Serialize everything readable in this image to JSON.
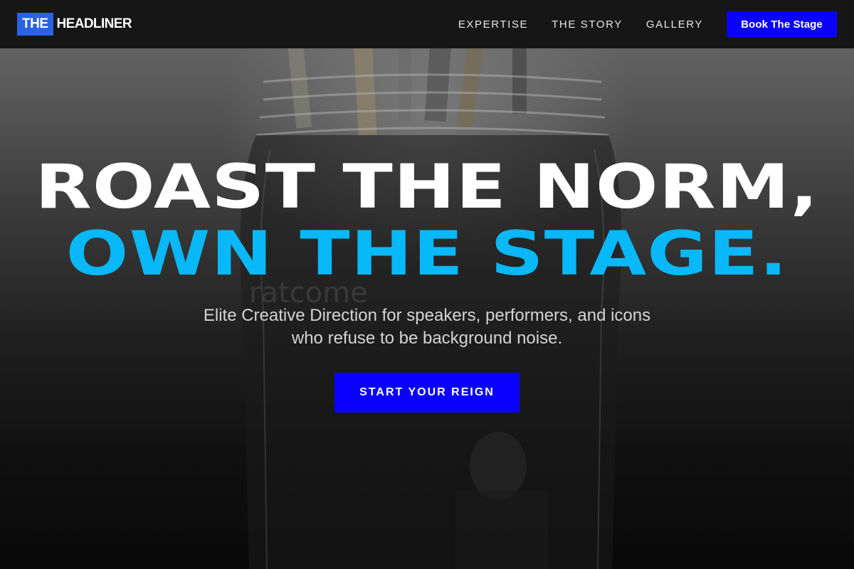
{
  "brand": {
    "logo_the": "THE",
    "logo_rest": "HEADLINER",
    "accent": "#0a00ff",
    "highlight": "#08b8f8",
    "logo_bg": "#2a62e4"
  },
  "nav": {
    "links": [
      "EXPERTISE",
      "THE STORY",
      "GALLERY"
    ],
    "cta_label": "Book The Stage"
  },
  "hero": {
    "headline_line1": "ROAST THE NORM,",
    "headline_line2": "OWN THE STAGE.",
    "subtitle_line1": "Elite Creative Direction for speakers, performers, and icons",
    "subtitle_line2": "who refuse to be background noise.",
    "cta_label": "START YOUR REIGN"
  },
  "background": {
    "description_icon": "brush-jar-photo",
    "watermark_text": "ratcome"
  }
}
